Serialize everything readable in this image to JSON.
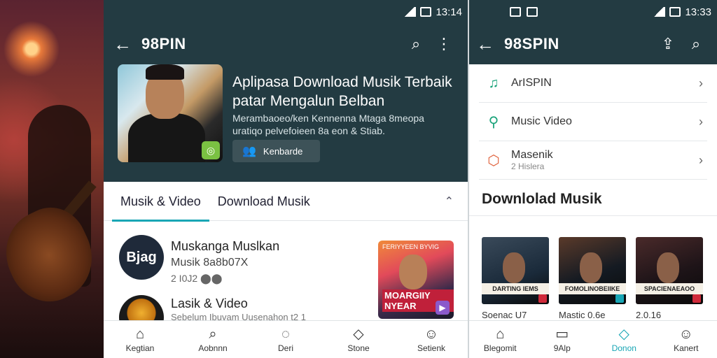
{
  "left_screen": {
    "status": {
      "time": "13:14"
    },
    "appbar": {
      "title": "98PIN",
      "back_icon": "arrow-left-icon",
      "search_icon": "search-icon",
      "menu_icon": "more-vert-icon"
    },
    "hero": {
      "title": "Aplipasa Download Musik Terbaik patar Mengalun Belban",
      "subtitle": "Merambaoeo/ken Kennenna Mtaga 8meopa uratiqo pelvefoieen 8a eon & Stiab.",
      "button_label": "Kenbarde"
    },
    "tabs": [
      {
        "label": "Musik & Video"
      },
      {
        "label": "Download Musik"
      }
    ],
    "list": [
      {
        "avatar_text": "Bjag",
        "title": "Muskanga Muslkan",
        "sub": "Musik 8a8b07X",
        "meta": "2 I0J2 ⬤⬤"
      },
      {
        "avatar_text": "",
        "title": "Lasik & Video",
        "sub": "Sebelum Ibuvam Uusenahon t2 1",
        "meta": ""
      }
    ],
    "album": {
      "top_text": "FERIYYEEN BYVIG",
      "cover_text": "MOARGIIY NYEAR"
    },
    "bottom_nav": [
      {
        "label": "Kegtian",
        "icon": "home-icon"
      },
      {
        "label": "Aobnnn",
        "icon": "search-icon"
      },
      {
        "label": "Deri",
        "icon": "chat-icon"
      },
      {
        "label": "Stone",
        "icon": "bookmark-icon"
      },
      {
        "label": "Setienk",
        "icon": "user-icon"
      }
    ]
  },
  "right_screen": {
    "status": {
      "time": "13:33"
    },
    "appbar": {
      "title": "98SPIN",
      "back_icon": "arrow-left-icon",
      "upload_icon": "upload-icon",
      "search_icon": "search-icon"
    },
    "menu": [
      {
        "label": "ArISPIN",
        "sub": "",
        "icon": "music-file-icon"
      },
      {
        "label": "Music Video",
        "sub": "",
        "icon": "magnify-music-icon"
      },
      {
        "label": "Masenik",
        "sub": "2 Hislera",
        "icon": "box-icon"
      }
    ],
    "section_title": "Downlolad Musik",
    "albums": [
      {
        "caption": "Soenac U7",
        "cover_text": "DARTING IEMS",
        "color": "#1a2a3a"
      },
      {
        "caption": "Mastic 0.6e",
        "cover_text": "FOMOLINOBEIIKE",
        "color": "#141a22"
      },
      {
        "caption": "2.0.16",
        "cover_text": "SPACIENAEAOO",
        "color": "#1e1418"
      }
    ],
    "bottom_nav": [
      {
        "label": "Blegomit",
        "icon": "home-icon"
      },
      {
        "label": "9Alp",
        "icon": "chat-icon"
      },
      {
        "label": "Donon",
        "icon": "bookmark-icon"
      },
      {
        "label": "Kanert",
        "icon": "user-icon"
      }
    ]
  },
  "colors": {
    "primary": "#233b42",
    "accent": "#19a6b5"
  }
}
